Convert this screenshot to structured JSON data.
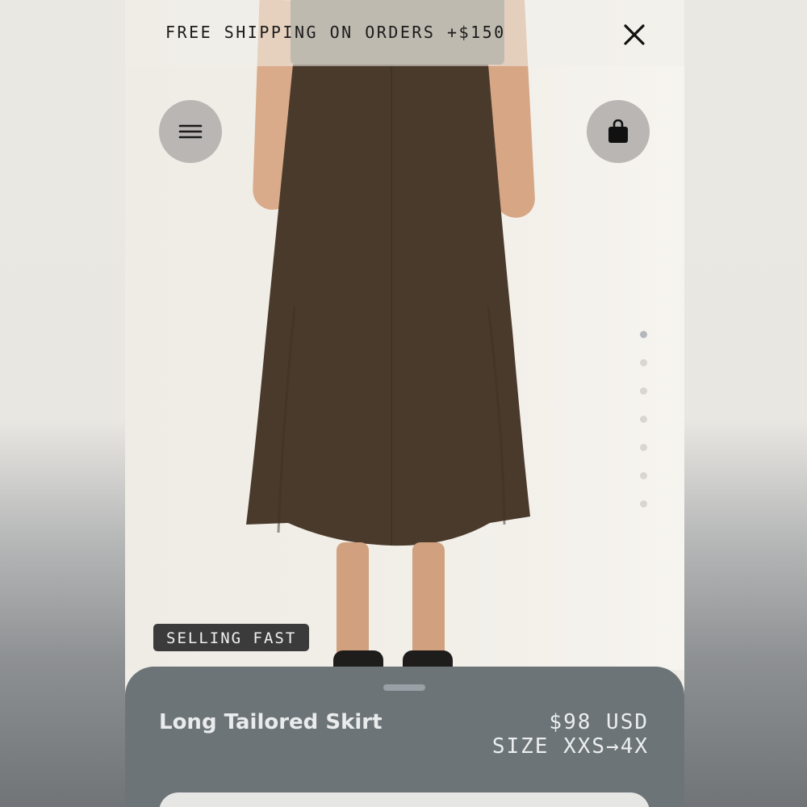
{
  "banner": {
    "text": "FREE SHIPPING ON ORDERS +$150"
  },
  "icons": {
    "close": "close-icon",
    "menu": "hamburger-menu-icon",
    "bag": "shopping-bag-icon"
  },
  "gallery": {
    "total": 7,
    "active_index": 0
  },
  "badge": {
    "text": "SELLING FAST"
  },
  "product": {
    "name": "Long Tailored Skirt",
    "price": "$98 USD",
    "sizes": "SIZE XXS→4X"
  },
  "colors": {
    "sheet": "#6c7478",
    "badge_bg": "#3b3b3b",
    "skirt": "#4a3a2c"
  }
}
